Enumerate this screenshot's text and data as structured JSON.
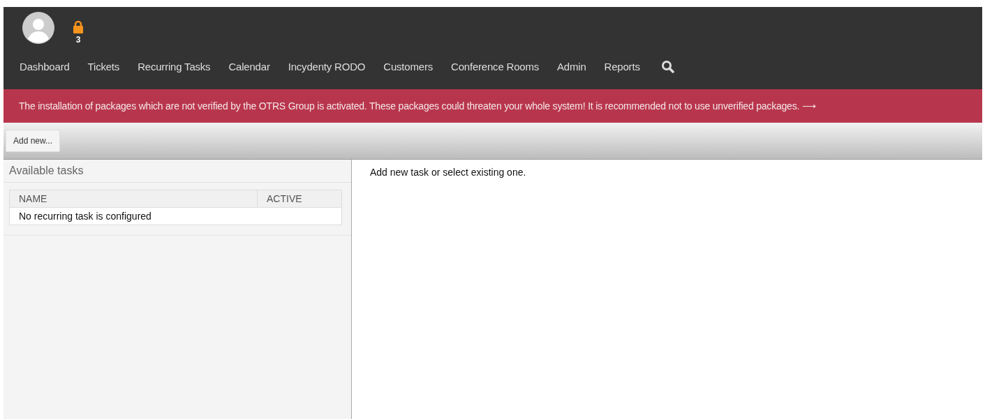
{
  "header": {
    "lock_count": "3"
  },
  "nav": [
    {
      "label": "Dashboard"
    },
    {
      "label": "Tickets"
    },
    {
      "label": "Recurring Tasks"
    },
    {
      "label": "Calendar"
    },
    {
      "label": "Incydenty RODO"
    },
    {
      "label": "Customers"
    },
    {
      "label": "Conference Rooms"
    },
    {
      "label": "Admin"
    },
    {
      "label": "Reports"
    }
  ],
  "banner": {
    "text": "The installation of packages which are not verified by the OTRS Group is activated. These packages could threaten your whole system! It is recommended not to use unverified packages. ⟶"
  },
  "toolbar": {
    "button": "Add new..."
  },
  "sidebar": {
    "title": "Available tasks",
    "table": {
      "columns": [
        "NAME",
        "ACTIVE"
      ],
      "empty_message": "No recurring task is configured"
    }
  },
  "content": {
    "message": "Add new task or select existing one."
  }
}
